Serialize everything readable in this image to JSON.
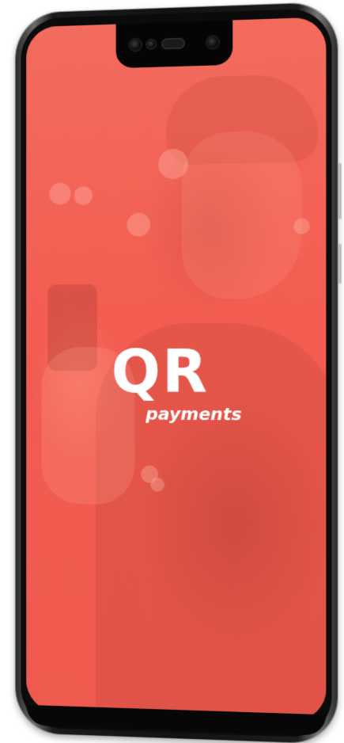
{
  "app": {
    "logo_title": "QR",
    "logo_subtitle": "payments"
  },
  "colors": {
    "screen_background": "#f25e52",
    "logo_text": "#ffffff",
    "phone_frame": "#121212"
  },
  "icons": {
    "front_camera": "front-camera-icon",
    "speaker": "speaker-grille-icon"
  }
}
